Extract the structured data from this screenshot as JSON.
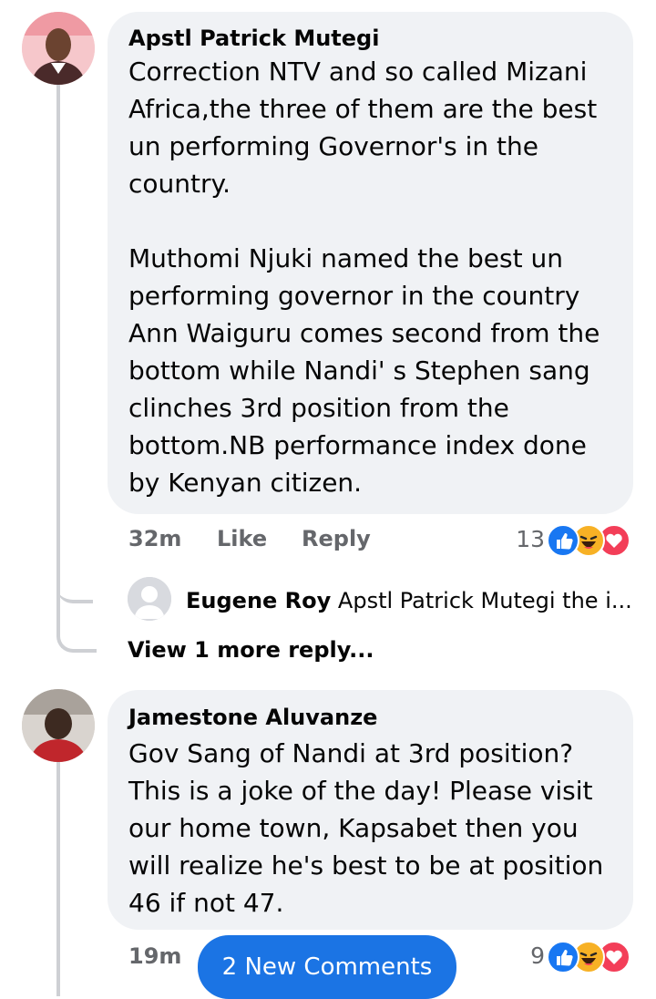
{
  "comments": [
    {
      "author": "Apstl Patrick Mutegi",
      "text": "Correction NTV and so called Mizani Africa,the three of them are the best un performing Governor's in the country.\n\nMuthomi Njuki named the best un performing governor in the country Ann Waiguru comes second from the bottom while Nandi' s Stephen sang clinches 3rd position from the bottom.NB performance index done by Kenyan citizen.",
      "time": "32m",
      "like_label": "Like",
      "reply_label": "Reply",
      "reaction_count": "13",
      "reactions": [
        "like-icon",
        "haha-icon",
        "love-icon"
      ],
      "reply_preview": {
        "author": "Eugene Roy",
        "text": "Apstl Patrick Mutegi the i..."
      },
      "view_more": "View 1 more reply..."
    },
    {
      "author": "Jamestone Aluvanze",
      "text": "Gov Sang of Nandi at 3rd position? This is a joke of the day! Please visit our home town, Kapsabet then you will realize he's best to be at position 46 if not 47.",
      "time": "19m",
      "reaction_count": "9",
      "reactions": [
        "like-icon",
        "haha-icon",
        "love-icon"
      ]
    }
  ],
  "new_comments_label": "2 New Comments",
  "colors": {
    "like": "#1877f2",
    "haha": "#f7b125",
    "love": "#f33e58",
    "bubble": "#f0f2f5",
    "pill": "#1b74e4"
  }
}
